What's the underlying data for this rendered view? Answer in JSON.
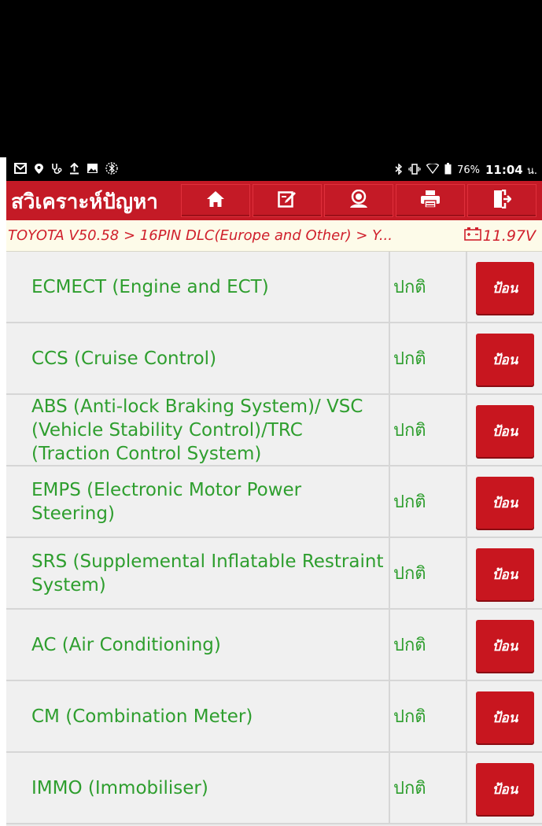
{
  "statusbar": {
    "left_icons": [
      "mail-icon",
      "location-pin-icon",
      "stethoscope-icon",
      "upload-icon",
      "image-icon",
      "bluetooth-circle-icon"
    ],
    "battery": "76%",
    "time": "11:04",
    "time_suffix": "น."
  },
  "appbar": {
    "title": "สวิเคราะห์ปัญหา",
    "buttons": [
      "home-icon",
      "edit-icon",
      "support-icon",
      "print-icon",
      "exit-icon"
    ]
  },
  "breadcrumb": {
    "path": "TOYOTA V50.58 > 16PIN DLC(Europe and Other) > Y...",
    "voltage": "11.97V"
  },
  "systems": [
    {
      "name": "ECMECT (Engine and ECT)",
      "status": "ปกติ",
      "button": "ป้อน"
    },
    {
      "name": "CCS (Cruise Control)",
      "status": "ปกติ",
      "button": "ป้อน"
    },
    {
      "name": "ABS (Anti-lock Braking System)/ VSC (Vehicle Stability Control)/TRC (Traction Control System)",
      "status": "ปกติ",
      "button": "ป้อน"
    },
    {
      "name": "EMPS (Electronic Motor Power Steering)",
      "status": "ปกติ",
      "button": "ป้อน"
    },
    {
      "name": "SRS (Supplemental Inflatable Restraint System)",
      "status": "ปกติ",
      "button": "ป้อน"
    },
    {
      "name": "AC (Air Conditioning)",
      "status": "ปกติ",
      "button": "ป้อน"
    },
    {
      "name": "CM (Combination Meter)",
      "status": "ปกติ",
      "button": "ป้อน"
    },
    {
      "name": "IMMO (Immobiliser)",
      "status": "ปกติ",
      "button": "ป้อน"
    }
  ],
  "colors": {
    "brand_red": "#c41a26",
    "status_green": "#2e9e2e",
    "breadcrumb_red": "#d0202c"
  }
}
